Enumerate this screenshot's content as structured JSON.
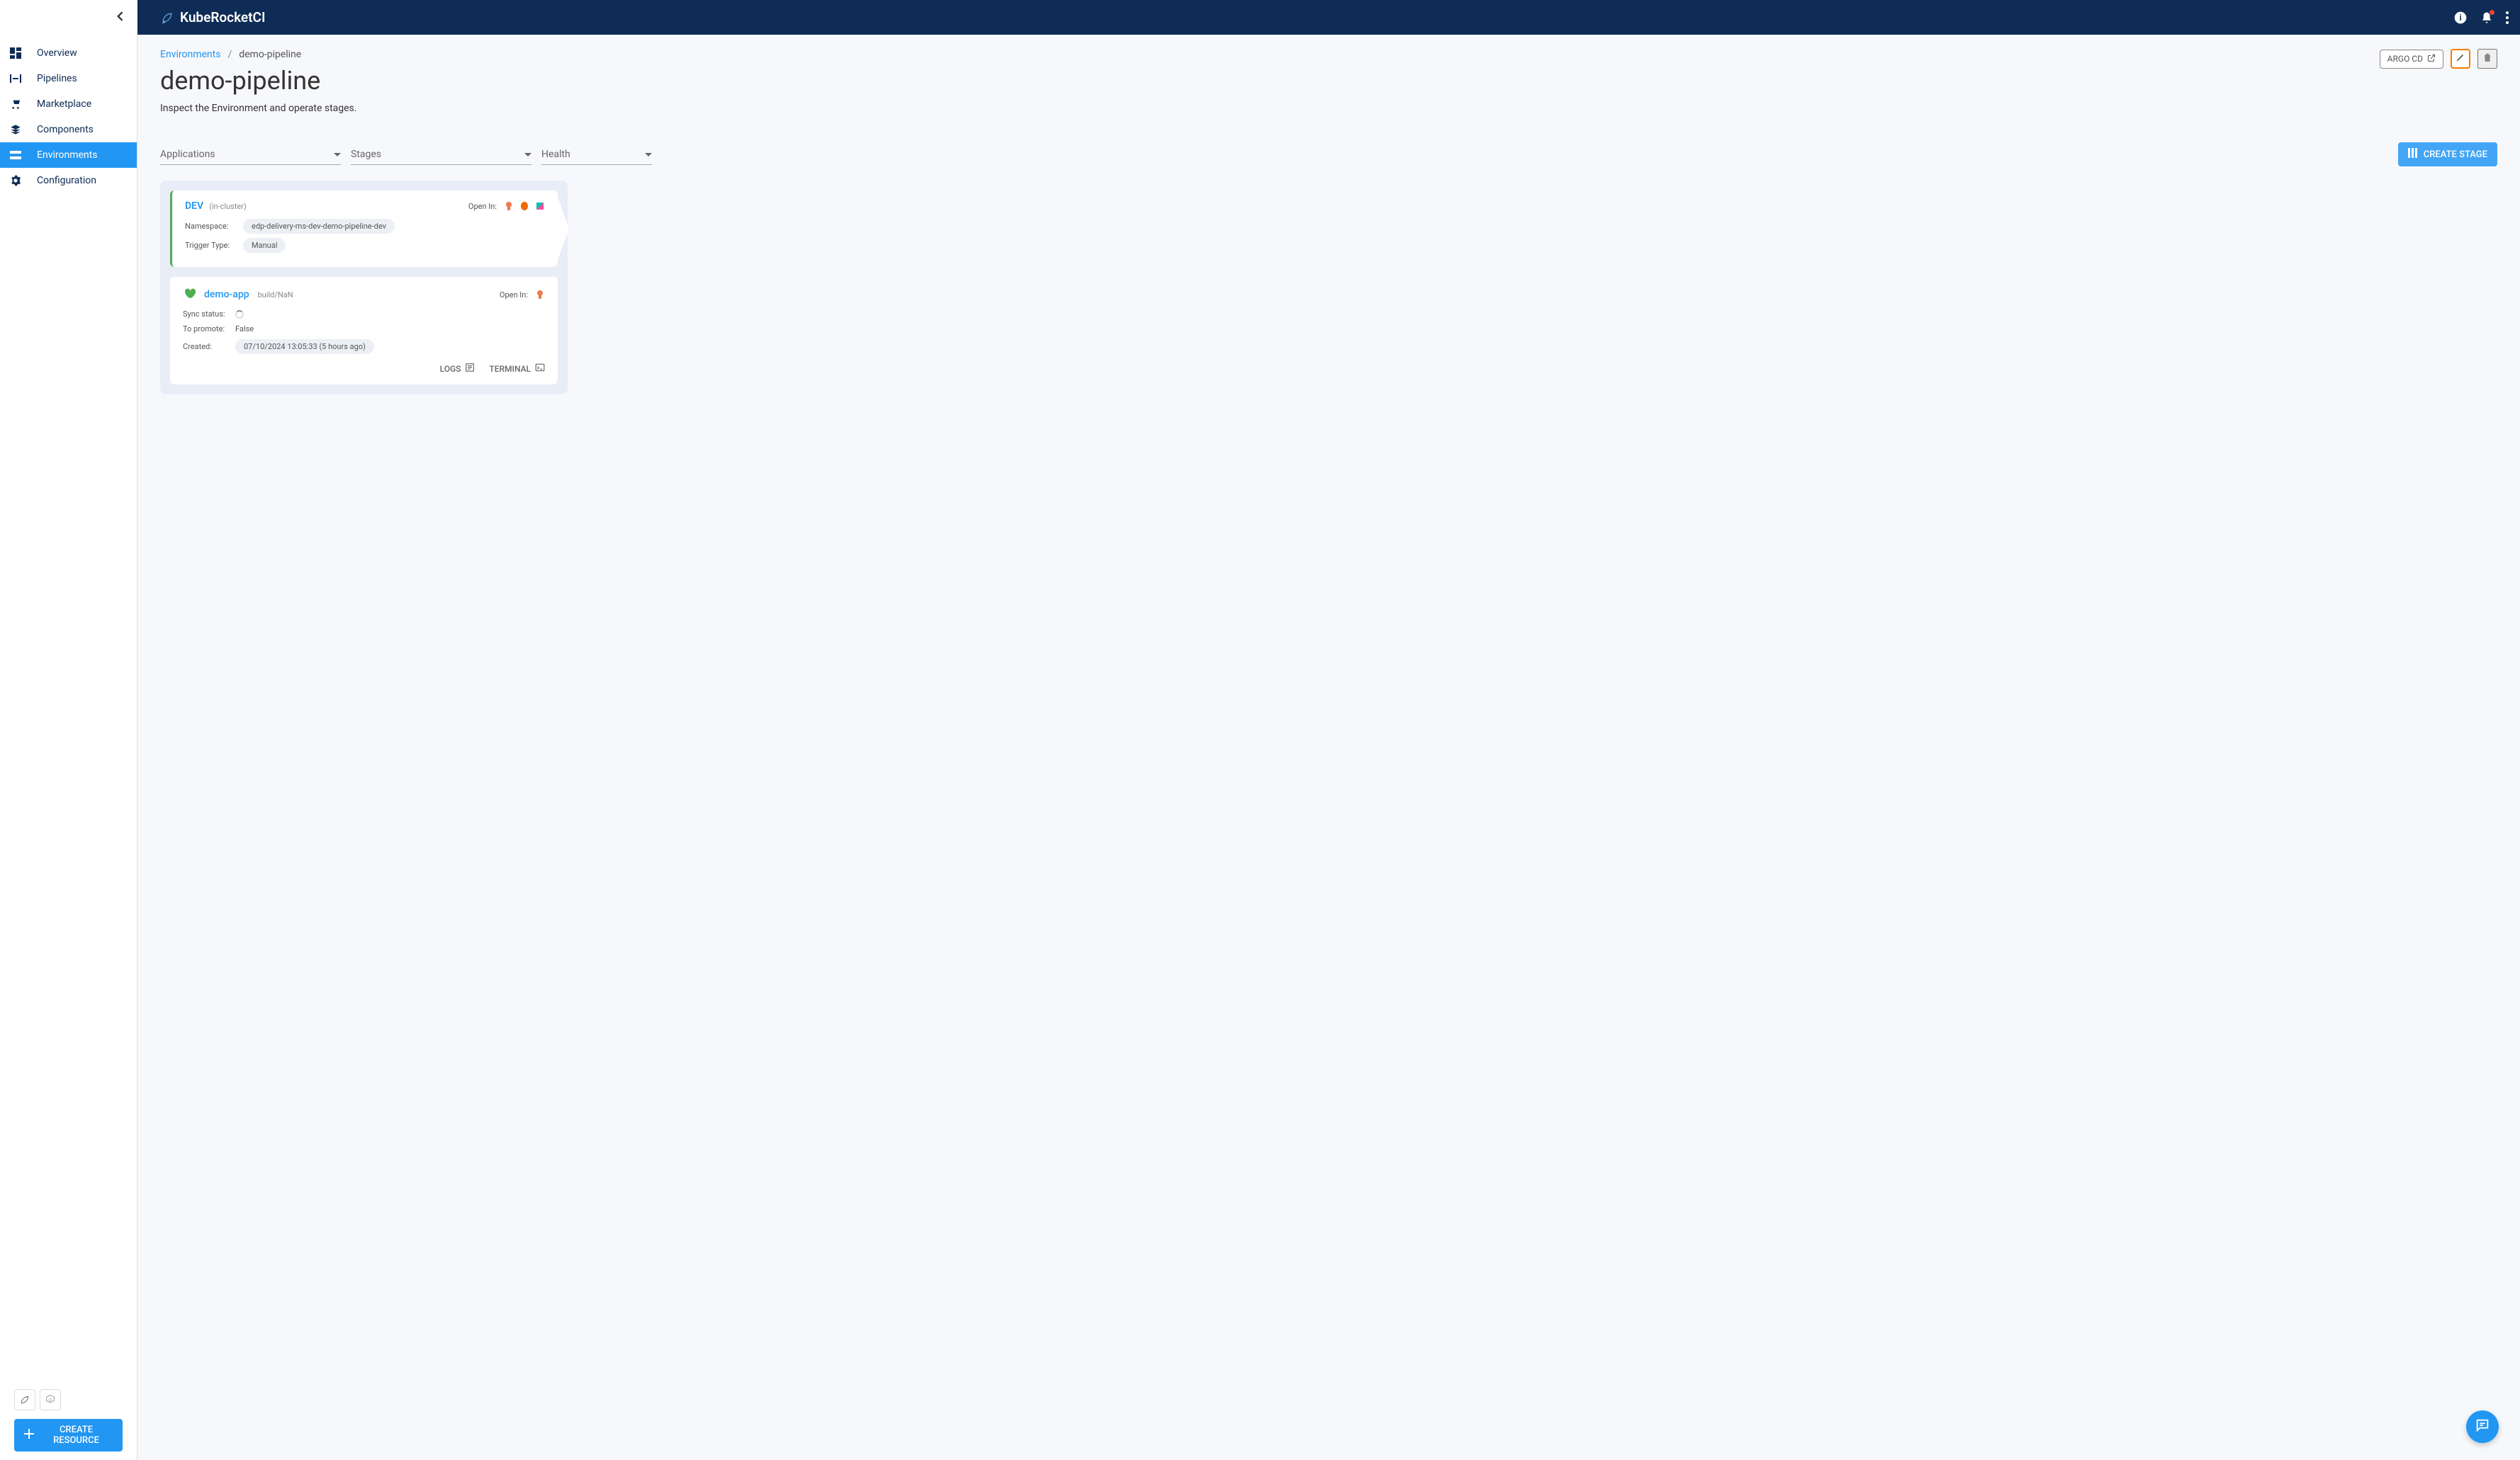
{
  "brand": "KubeRocketCI",
  "sidebar": {
    "items": [
      {
        "label": "Overview"
      },
      {
        "label": "Pipelines"
      },
      {
        "label": "Marketplace"
      },
      {
        "label": "Components"
      },
      {
        "label": "Environments"
      },
      {
        "label": "Configuration"
      }
    ],
    "create_resource_label": "CREATE RESOURCE"
  },
  "breadcrumb": {
    "parent": "Environments",
    "sep": "/",
    "current": "demo-pipeline"
  },
  "page": {
    "title": "demo-pipeline",
    "subtitle": "Inspect the Environment and operate stages."
  },
  "actions": {
    "argo_label": "ARGO CD"
  },
  "filters": {
    "applications": "Applications",
    "stages": "Stages",
    "health": "Health"
  },
  "create_stage_label": "CREATE STAGE",
  "stage": {
    "name": "DEV",
    "cluster": "(in-cluster)",
    "open_in_label": "Open In:",
    "namespace_label": "Namespace:",
    "namespace_value": "edp-delivery-ms-dev-demo-pipeline-dev",
    "trigger_label": "Trigger Type:",
    "trigger_value": "Manual"
  },
  "app": {
    "name": "demo-app",
    "build": "build/NaN",
    "open_in_label": "Open In:",
    "sync_label": "Sync status:",
    "promote_label": "To promote:",
    "promote_value": "False",
    "created_label": "Created:",
    "created_value": "07/10/2024 13:05:33 (5 hours ago)",
    "logs_label": "LOGS",
    "terminal_label": "TERMINAL"
  }
}
